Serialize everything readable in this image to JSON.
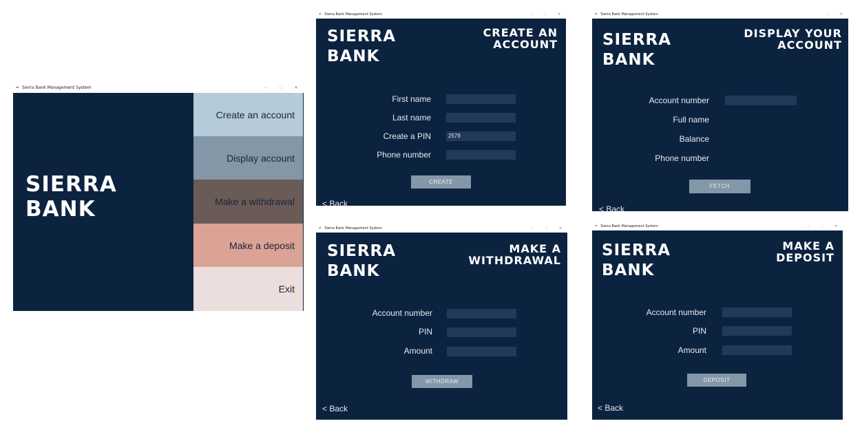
{
  "app_title": "Sierra Bank Management System",
  "brand_line1": "SIERRA",
  "brand_line2": "BANK",
  "window_controls": {
    "minimize": "–",
    "maximize": "□",
    "close": "✕"
  },
  "icons": {
    "app": "feather-icon"
  },
  "colors": {
    "navy": "#0c2340",
    "menu_create": "#b5cbd9",
    "menu_display": "#8497a7",
    "menu_withdraw": "#6b5b57",
    "menu_deposit": "#dba395",
    "menu_exit": "#ecdedd"
  },
  "main_menu": {
    "create": "Create an account",
    "display": "Display account",
    "withdraw": "Make a withdrawal",
    "deposit": "Make a deposit",
    "exit": "Exit"
  },
  "create_screen": {
    "heading_line1": "CREATE AN",
    "heading_line2": "ACCOUNT",
    "first_name_label": "First name",
    "last_name_label": "Last name",
    "pin_label": "Create a PIN",
    "pin_value": "2579",
    "phone_label": "Phone number",
    "button": "CREATE",
    "back": "< Back"
  },
  "display_screen": {
    "heading_line1": "DISPLAY YOUR",
    "heading_line2": "ACCOUNT",
    "account_number_label": "Account number",
    "full_name_label": "Full name",
    "balance_label": "Balance",
    "phone_label": "Phone number",
    "button": "FETCH",
    "back": "< Back"
  },
  "withdraw_screen": {
    "heading_line1": "MAKE A",
    "heading_line2": "WITHDRAWAL",
    "account_number_label": "Account number",
    "pin_label": "PIN",
    "amount_label": "Amount",
    "button": "WITHDRAW",
    "back": "< Back"
  },
  "deposit_screen": {
    "heading_line1": "MAKE A",
    "heading_line2": "DEPOSIT",
    "account_number_label": "Account number",
    "pin_label": "PIN",
    "amount_label": "Amount",
    "button": "DEPOSIT",
    "back": "< Back"
  }
}
